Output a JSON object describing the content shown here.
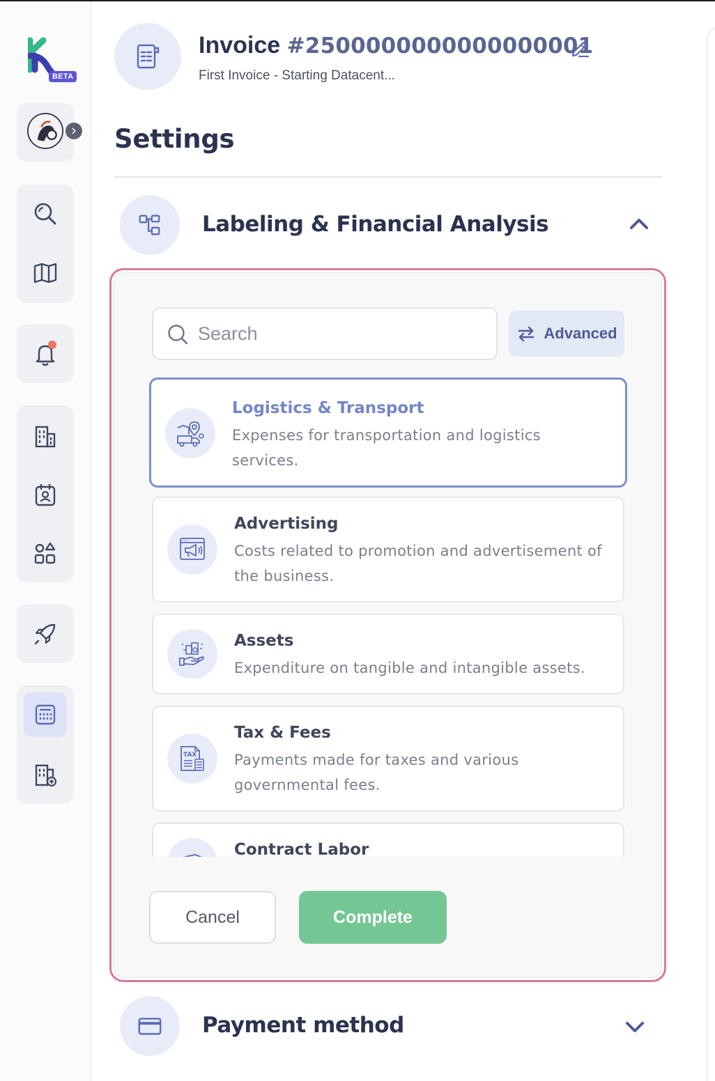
{
  "sidebar": {
    "logo_badge": "BETA",
    "items": [
      {
        "name": "search"
      },
      {
        "name": "library"
      },
      {
        "name": "notifications"
      },
      {
        "name": "companies"
      },
      {
        "name": "contacts"
      },
      {
        "name": "categories"
      },
      {
        "name": "launch"
      },
      {
        "name": "invoices",
        "active": true
      },
      {
        "name": "new-record"
      }
    ]
  },
  "header": {
    "title": "Invoice",
    "number": "#2500000000000000001",
    "subtitle": "First Invoice - Starting Datacent..."
  },
  "page": {
    "title": "Settings"
  },
  "sections": {
    "labeling": {
      "title": "Labeling & Financial Analysis",
      "expanded": true
    },
    "payment": {
      "title": "Payment method",
      "expanded": false
    }
  },
  "search": {
    "placeholder": "Search",
    "value": ""
  },
  "advanced_label": "Advanced",
  "categories": [
    {
      "title": "Logistics & Transport",
      "description": "Expenses for transportation and logistics services.",
      "icon": "truck-map-icon",
      "selected": true
    },
    {
      "title": "Advertising",
      "description": "Costs related to promotion and advertisement of the business.",
      "icon": "megaphone-icon",
      "selected": false
    },
    {
      "title": "Assets",
      "description": "Expenditure on tangible and intangible assets.",
      "icon": "hand-building-icon",
      "selected": false
    },
    {
      "title": "Tax & Fees",
      "description": "Payments made for taxes and various governmental fees.",
      "icon": "tax-document-icon",
      "selected": false
    },
    {
      "title": "Contract Labor",
      "description": "",
      "icon": "contract-icon",
      "selected": false
    }
  ],
  "actions": {
    "cancel": "Cancel",
    "complete": "Complete"
  },
  "colors": {
    "accent": "#4d5a99",
    "selected_border": "#7d8fc9",
    "complete": "#74c795",
    "focus_outline": "#d77a98",
    "icon_bg": "#e8ecf8"
  }
}
